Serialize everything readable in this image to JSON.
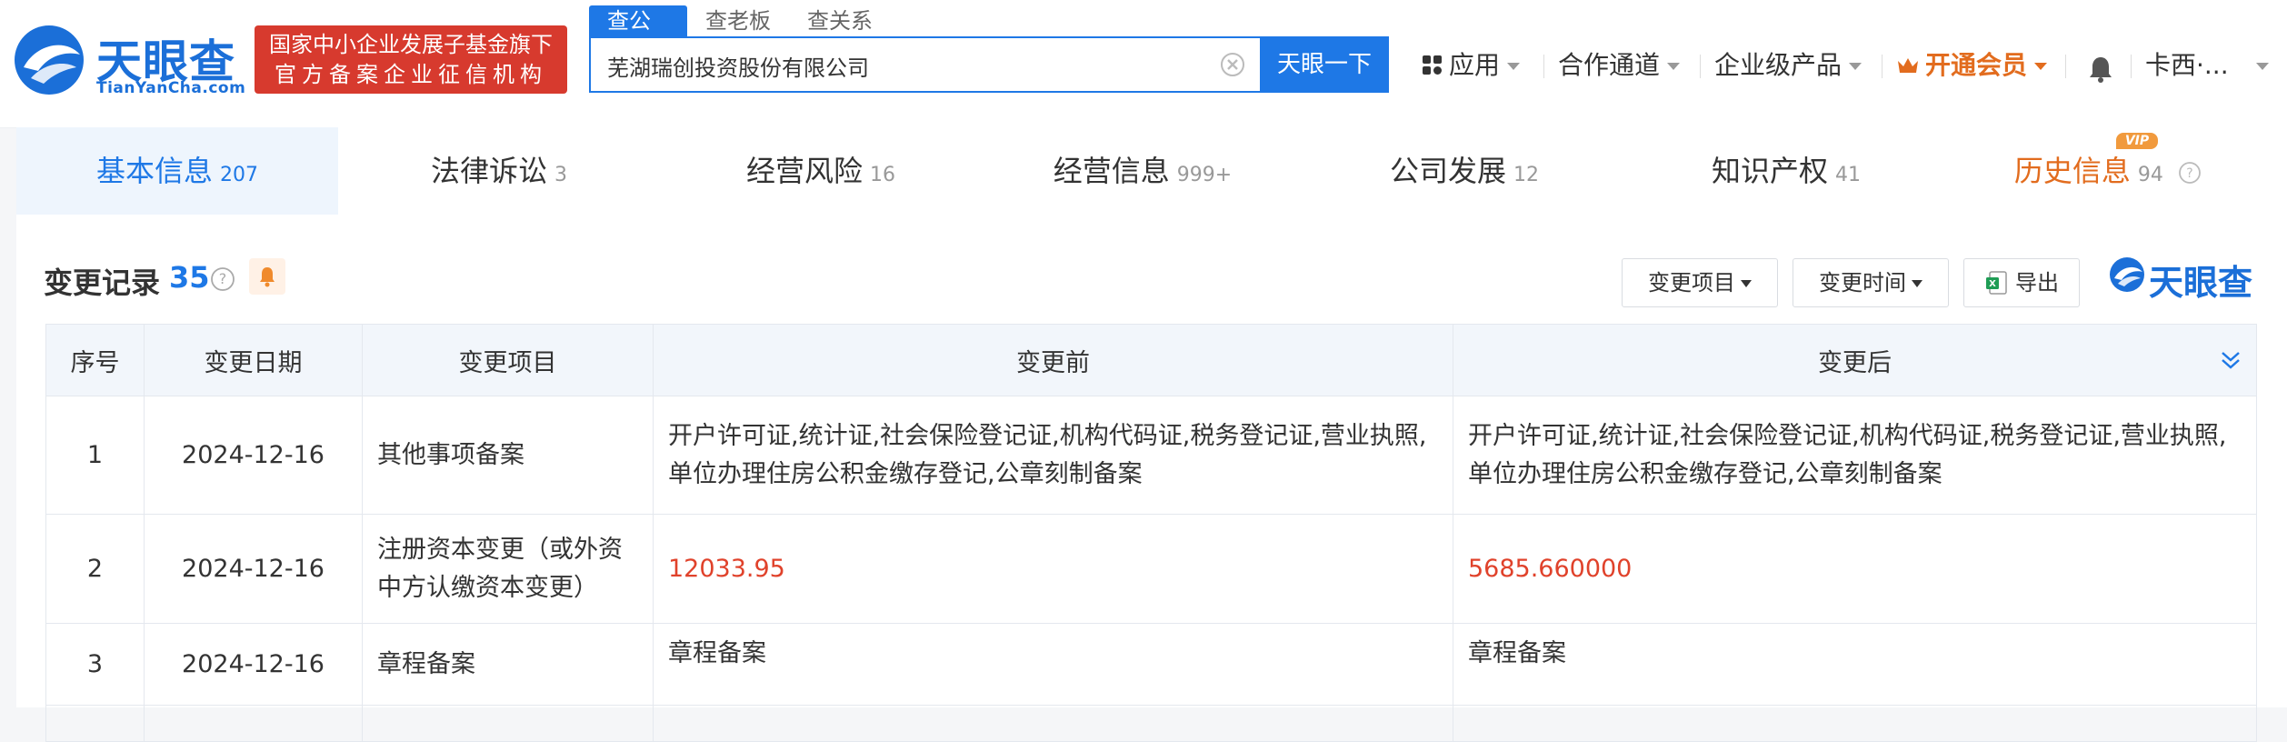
{
  "brand": {
    "name_cn": "天眼查",
    "name_en": "TianYanCha.com",
    "banner_line1": "国家中小企业发展子基金旗下",
    "banner_line2": "官方备案企业征信机构",
    "color": "#1b6fd8"
  },
  "search": {
    "tabs": [
      "查公司",
      "查老板",
      "查关系"
    ],
    "active_tab": 0,
    "value": "芜湖瑞创投资股份有限公司",
    "button": "天眼一下"
  },
  "topnav": {
    "items": [
      "应用",
      "合作通道",
      "企业级产品",
      "开通会员"
    ],
    "user": "卡西·..."
  },
  "tabs": [
    {
      "label": "基本信息",
      "count": "207"
    },
    {
      "label": "法律诉讼",
      "count": "3"
    },
    {
      "label": "经营风险",
      "count": "16"
    },
    {
      "label": "经营信息",
      "count": "999+"
    },
    {
      "label": "公司发展",
      "count": "12"
    },
    {
      "label": "知识产权",
      "count": "41"
    },
    {
      "label": "历史信息",
      "count": "94"
    }
  ],
  "vip_badge": "VIP",
  "section": {
    "title": "变更记录",
    "count": "35",
    "filters": [
      "变更项目",
      "变更时间"
    ],
    "export": "导出",
    "brand": "天眼查"
  },
  "table": {
    "headers": [
      "序号",
      "变更日期",
      "变更项目",
      "变更前",
      "变更后"
    ],
    "rows": [
      {
        "no": "1",
        "date": "2024-12-16",
        "item": "其他事项备案",
        "before": "开户许可证,统计证,社会保险登记证,机构代码证,税务登记证,营业执照,单位办理住房公积金缴存登记,公章刻制备案",
        "after": "开户许可证,统计证,社会保险登记证,机构代码证,税务登记证,营业执照,单位办理住房公积金缴存登记,公章刻制备案"
      },
      {
        "no": "2",
        "date": "2024-12-16",
        "item": "注册资本变更（或外资中方认缴资本变更）",
        "before": "12033.95",
        "after": "5685.660000"
      },
      {
        "no": "3",
        "date": "2024-12-16",
        "item": "章程备案",
        "before": "章程备案",
        "after": "章程备案"
      }
    ]
  },
  "colors": {
    "accent": "#1e78e6",
    "vip": "#e26c1e",
    "danger": "#e0422b",
    "banner": "#d73a2e"
  }
}
